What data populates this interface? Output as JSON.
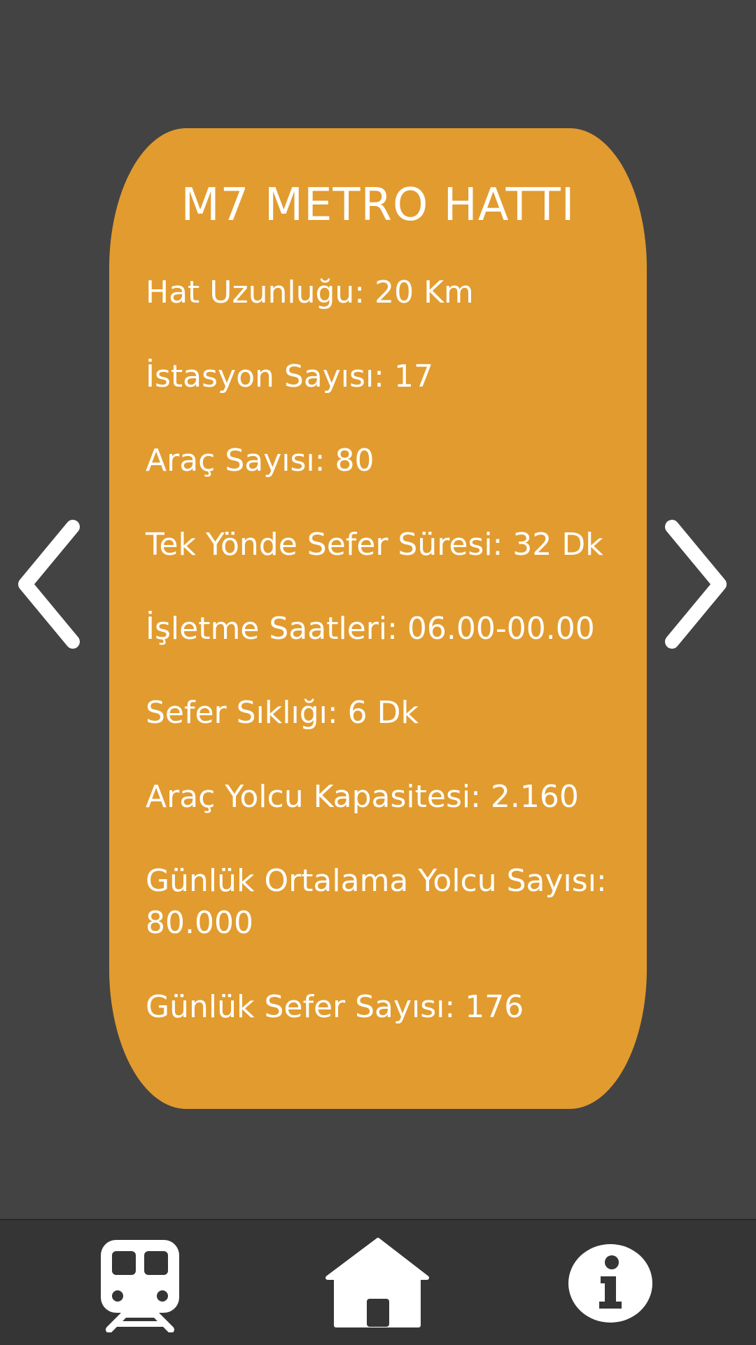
{
  "card": {
    "title": "M7 METRO HATTI",
    "rows": [
      "Hat Uzunluğu: 20 Km",
      "İstasyon Sayısı: 17",
      "Araç Sayısı: 80",
      "Tek Yönde Sefer Süresi: 32 Dk",
      "İşletme Saatleri: 06.00-00.00",
      "Sefer Sıklığı: 6 Dk",
      "Araç Yolcu Kapasitesi: 2.160",
      "Günlük Ortalama Yolcu Sayısı: 80.000",
      "Günlük Sefer Sayısı: 176"
    ]
  },
  "navigation": {
    "prev_icon": "chevron-left-icon",
    "next_icon": "chevron-right-icon"
  },
  "bottom_bar": {
    "tabs": [
      {
        "icon": "train-icon"
      },
      {
        "icon": "home-icon"
      },
      {
        "icon": "info-icon"
      }
    ]
  },
  "colors": {
    "background": "#434343",
    "card": "#e29b2e",
    "bottom_bar": "#353535",
    "text": "#ffffff"
  }
}
